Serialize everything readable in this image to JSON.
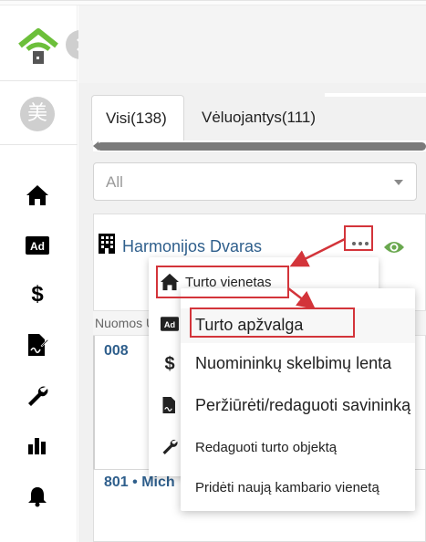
{
  "app": {
    "accent": "#2f5f8c",
    "annotation_color": "#d3343a",
    "logo_color": "#6cbf3a"
  },
  "sidebar": {
    "avatar_text": "美",
    "items": [
      {
        "icon": "home-icon"
      },
      {
        "icon": "ad-icon",
        "label": "Ad"
      },
      {
        "icon": "dollar-icon",
        "label": "$"
      },
      {
        "icon": "contract-signature-icon"
      },
      {
        "icon": "wrench-icon"
      },
      {
        "icon": "bar-chart-icon"
      },
      {
        "icon": "bell-icon"
      }
    ]
  },
  "tabs": [
    {
      "label": "Visi(138)",
      "active": true
    },
    {
      "label": "Vėluojantys(111)",
      "active": false
    }
  ],
  "filter": {
    "selected": "All"
  },
  "property": {
    "title": "Harmonijos Dvaras",
    "sub_header": "Nuomos U",
    "units": [
      {
        "label": "008"
      },
      {
        "label": "801 • Mich"
      }
    ]
  },
  "context_menu": {
    "items": [
      {
        "icon": "home-icon",
        "label": "Turto vienetas"
      },
      {
        "icon": "ad-icon",
        "label": "Ad"
      },
      {
        "icon": "dollar-icon",
        "label": "$"
      },
      {
        "icon": "contract-signature-icon"
      },
      {
        "icon": "wrench-icon"
      }
    ]
  },
  "submenu": {
    "items": [
      {
        "label": "Turto apžvalga"
      },
      {
        "label": "Nuomininkų skelbimų lenta"
      },
      {
        "label": "Peržiūrėti/redaguoti savininką"
      },
      {
        "label": "Redaguoti turto objektą"
      },
      {
        "label": "Pridėti naują kambario vienetą"
      }
    ]
  }
}
